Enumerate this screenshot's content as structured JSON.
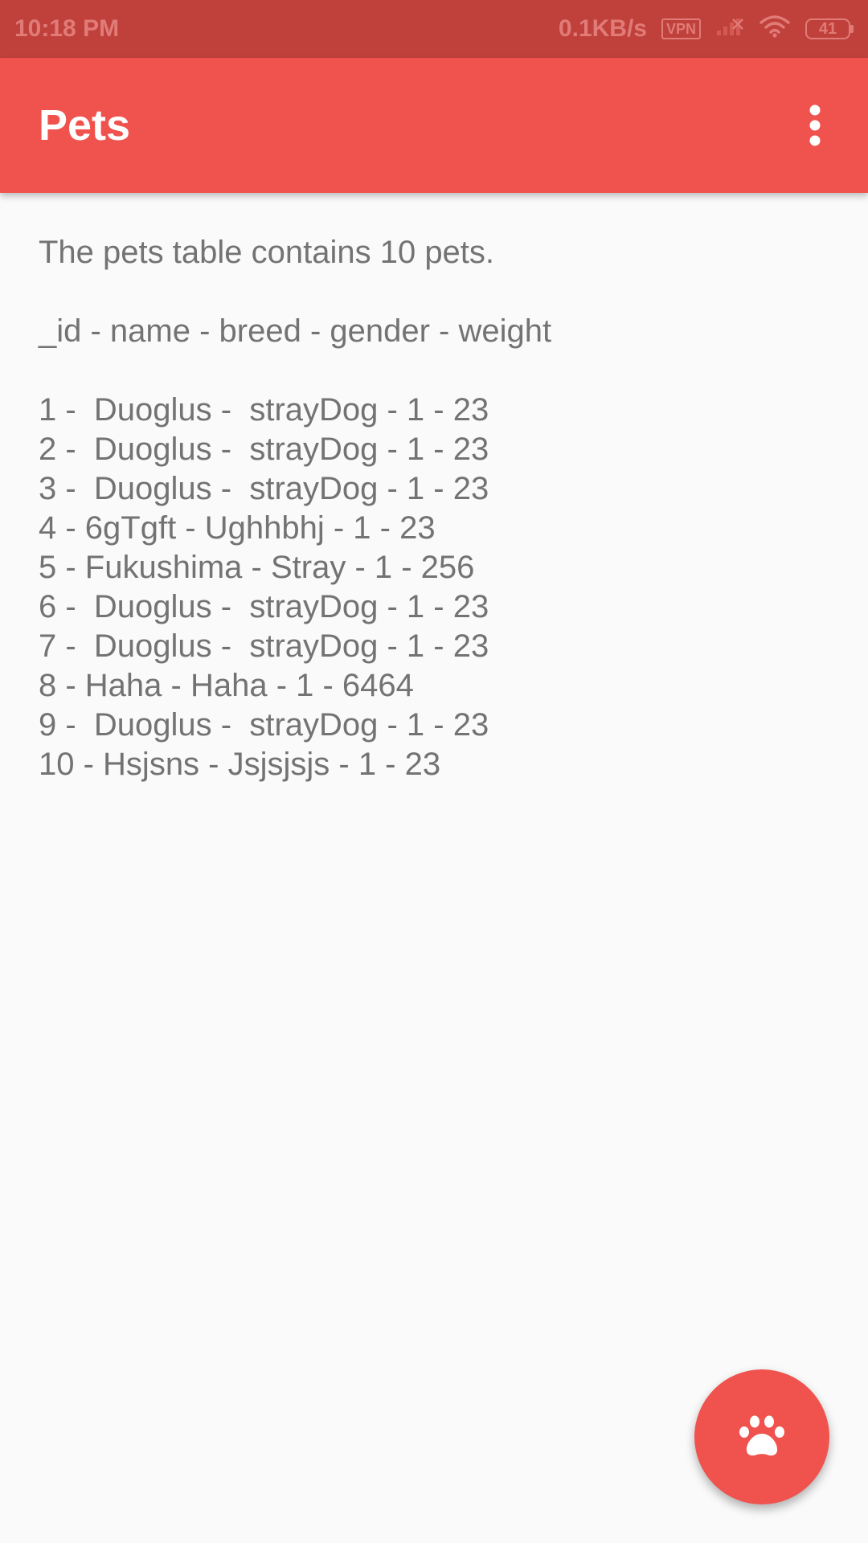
{
  "status_bar": {
    "time": "10:18 PM",
    "network_speed": "0.1KB/s",
    "vpn_label": "VPN",
    "battery_level": "41",
    "icons": [
      "signal-icon",
      "wifi-icon",
      "battery-icon"
    ]
  },
  "app_bar": {
    "title": "Pets",
    "menu_icon": "more-vert-icon"
  },
  "content": {
    "summary": "The pets table contains 10 pets.",
    "header": "_id - name - breed - gender - weight",
    "rows": [
      "1 -  Duoglus -  strayDog - 1 - 23",
      "2 -  Duoglus -  strayDog - 1 - 23",
      "3 -  Duoglus -  strayDog - 1 - 23",
      "4 - 6gTgft - Ughhbhj - 1 - 23",
      "5 - Fukushima - Stray - 1 - 256",
      "6 -  Duoglus -  strayDog - 1 - 23",
      "7 -  Duoglus -  strayDog - 1 - 23",
      "8 - Haha - Haha - 1 - 6464",
      "9 -  Duoglus -  strayDog - 1 - 23",
      "10 - Hsjsns - Jsjsjsjs - 1 - 23"
    ]
  },
  "fab": {
    "icon": "paw-icon"
  },
  "colors": {
    "primary": "#f0524d",
    "status_bar": "#c0413c",
    "text": "#737373",
    "background": "#fafafa"
  }
}
